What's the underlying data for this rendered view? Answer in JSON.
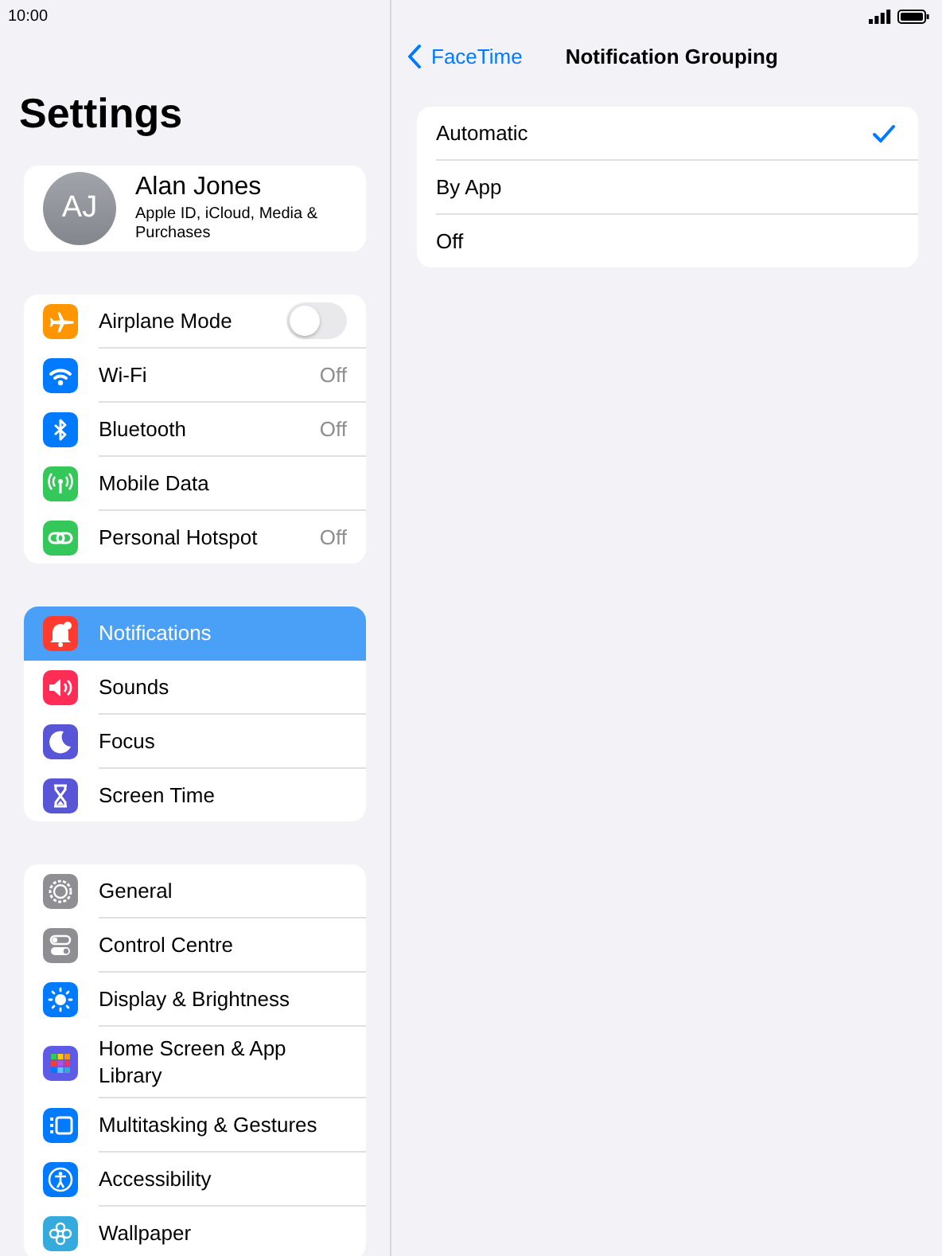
{
  "status_bar": {
    "time": "10:00"
  },
  "sidebar": {
    "title": "Settings",
    "profile": {
      "initials": "AJ",
      "name": "Alan Jones",
      "subtitle": "Apple ID, iCloud, Media & Purchases"
    },
    "groups": [
      {
        "items": [
          {
            "label": "Airplane Mode",
            "kind": "toggle",
            "on": false,
            "color": "#ff9500",
            "selected": false
          },
          {
            "label": "Wi-Fi",
            "kind": "value",
            "value": "Off",
            "color": "#007aff",
            "selected": false
          },
          {
            "label": "Bluetooth",
            "kind": "value",
            "value": "Off",
            "color": "#007aff",
            "selected": false
          },
          {
            "label": "Mobile Data",
            "kind": "plain",
            "color": "#34c759",
            "selected": false
          },
          {
            "label": "Personal Hotspot",
            "kind": "value",
            "value": "Off",
            "color": "#34c759",
            "selected": false
          }
        ]
      },
      {
        "items": [
          {
            "label": "Notifications",
            "kind": "plain",
            "color": "#ff3b30",
            "selected": true
          },
          {
            "label": "Sounds",
            "kind": "plain",
            "color": "#ff2d55",
            "selected": false
          },
          {
            "label": "Focus",
            "kind": "plain",
            "color": "#5856d6",
            "selected": false
          },
          {
            "label": "Screen Time",
            "kind": "plain",
            "color": "#5856d6",
            "selected": false
          }
        ]
      },
      {
        "items": [
          {
            "label": "General",
            "kind": "plain",
            "color": "#8e8e93",
            "selected": false
          },
          {
            "label": "Control Centre",
            "kind": "plain",
            "color": "#8e8e93",
            "selected": false
          },
          {
            "label": "Display & Brightness",
            "kind": "plain",
            "color": "#007aff",
            "selected": false
          },
          {
            "label": "Home Screen & App Library",
            "kind": "plain",
            "color": "#5e5ce6",
            "selected": false
          },
          {
            "label": "Multitasking & Gestures",
            "kind": "plain",
            "color": "#007aff",
            "selected": false
          },
          {
            "label": "Accessibility",
            "kind": "plain",
            "color": "#007aff",
            "selected": false
          },
          {
            "label": "Wallpaper",
            "kind": "plain",
            "color": "#35aadc",
            "selected": false
          }
        ]
      }
    ]
  },
  "detail": {
    "back": "FaceTime",
    "title": "Notification Grouping",
    "options": [
      {
        "label": "Automatic",
        "selected": true
      },
      {
        "label": "By App",
        "selected": false
      },
      {
        "label": "Off",
        "selected": false
      }
    ]
  }
}
